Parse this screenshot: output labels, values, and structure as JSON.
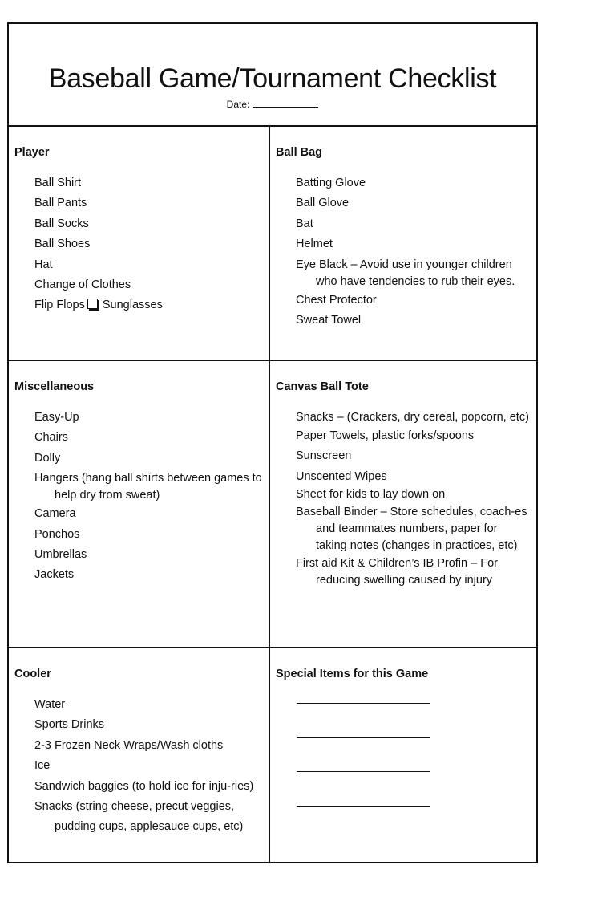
{
  "header": {
    "title": "Baseball Game/Tournament Checklist",
    "date_label": "Date:"
  },
  "sections": {
    "player": {
      "title": "Player",
      "items": [
        "Ball Shirt",
        "Ball Pants",
        "Ball Socks",
        "Ball Shoes",
        "Hat",
        "Change of Clothes"
      ],
      "last_item_part1": "Flip Flops",
      "last_item_part2": "Sunglasses"
    },
    "ball_bag": {
      "title": "Ball Bag",
      "items": [
        "Batting Glove",
        "Ball Glove",
        "Bat",
        "Helmet",
        "Eye Black – Avoid use in younger children who have tendencies to rub their eyes.",
        "Chest Protector",
        "Sweat Towel"
      ]
    },
    "miscellaneous": {
      "title": "Miscellaneous",
      "items": [
        "Easy-Up",
        "Chairs",
        "Dolly",
        "Hangers (hang ball shirts between games to help dry from sweat)",
        "Camera",
        "Ponchos",
        "Umbrellas",
        "Jackets"
      ]
    },
    "canvas_ball_tote": {
      "title": "Canvas Ball Tote",
      "items": [
        "Snacks – (Crackers, dry cereal, popcorn, etc)",
        "Paper Towels, plastic forks/spoons",
        "Sunscreen",
        "Unscented Wipes",
        "Sheet for kids to lay down on",
        "Baseball Binder – Store schedules, coach-es and teammates numbers, paper for taking notes (changes in practices, etc)",
        "First aid Kit & Children’s IB Profin – For reducing swelling caused by injury"
      ]
    },
    "cooler": {
      "title": "Cooler",
      "items": [
        "Water",
        "Sports Drinks",
        "2-3 Frozen Neck Wraps/Wash cloths",
        "Ice",
        "Sandwich baggies (to hold ice for inju-ries)",
        "Snacks (string cheese, precut veggies, pudding cups, applesauce cups, etc)"
      ]
    },
    "special_items": {
      "title": "Special Items for this Game",
      "blank_lines": 4
    }
  }
}
